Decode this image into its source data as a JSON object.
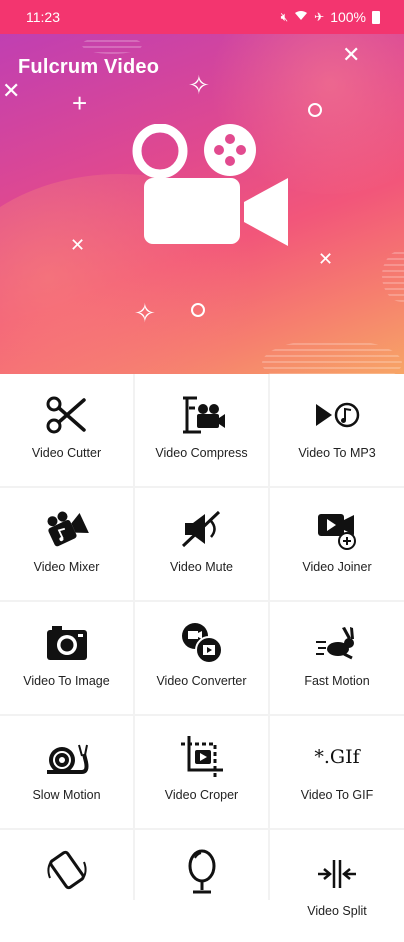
{
  "status_bar": {
    "time": "11:23",
    "battery": "100%"
  },
  "header": {
    "title": "Fulcrum Video"
  },
  "tools": [
    {
      "label": "Video Cutter",
      "icon": "scissors-icon"
    },
    {
      "label": "Video Compress",
      "icon": "clamp-camera-icon"
    },
    {
      "label": "Video To MP3",
      "icon": "play-music-icon"
    },
    {
      "label": "Video Mixer",
      "icon": "camera-music-icon"
    },
    {
      "label": "Video Mute",
      "icon": "mute-icon"
    },
    {
      "label": "Video Joiner",
      "icon": "video-add-icon"
    },
    {
      "label": "Video To Image",
      "icon": "photo-camera-icon"
    },
    {
      "label": "Video Converter",
      "icon": "convert-icon"
    },
    {
      "label": "Fast Motion",
      "icon": "rabbit-icon"
    },
    {
      "label": "Slow Motion",
      "icon": "snail-icon"
    },
    {
      "label": "Video Croper",
      "icon": "crop-icon"
    },
    {
      "label": "Video To GIF",
      "icon": "gif-icon",
      "glyph": "*.GIf"
    },
    {
      "label": "",
      "icon": "rotate-icon"
    },
    {
      "label": "",
      "icon": "mirror-icon"
    },
    {
      "label": "Video Split",
      "icon": "split-icon"
    }
  ]
}
